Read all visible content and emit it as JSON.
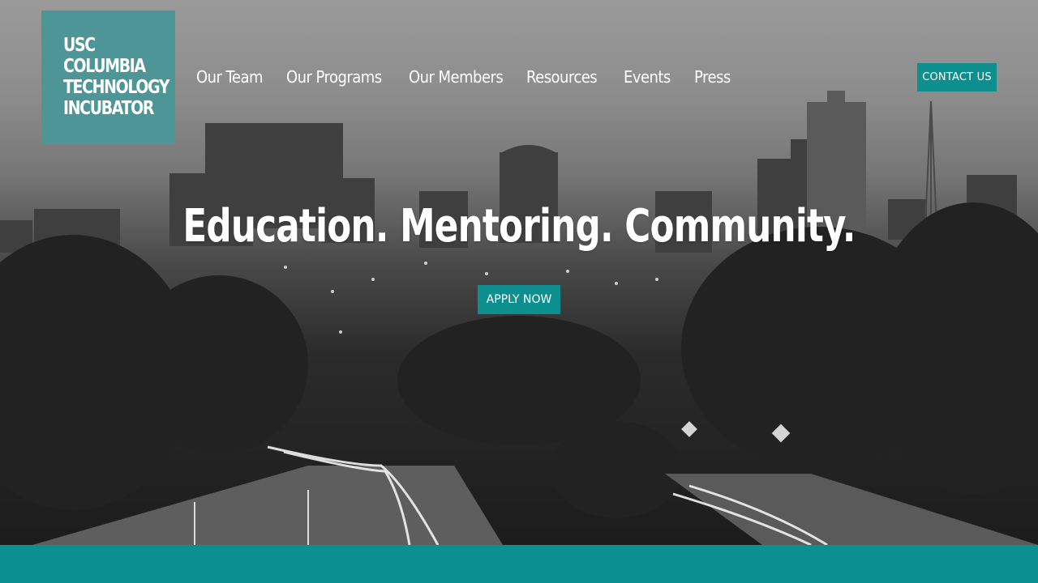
{
  "logo": {
    "lines": [
      "USC",
      "COLUMBIA",
      "TECHNOLOGY",
      "INCUBATOR"
    ],
    "background_color": "#4e9598"
  },
  "nav": {
    "items": [
      {
        "label": "Our Team"
      },
      {
        "label": "Our Programs"
      },
      {
        "label": "Our Members"
      },
      {
        "label": "Resources"
      },
      {
        "label": "Events"
      },
      {
        "label": "Press"
      }
    ]
  },
  "header": {
    "contact_label": "CONTACT US"
  },
  "hero": {
    "headline": "Education. Mentoring. Community.",
    "apply_label": "APPLY NOW",
    "image": "black-and-white city skyline at dusk with tree-lined highway and light trails"
  },
  "colors": {
    "accent": "#0e8f8f",
    "footer_band": "#0c8f91"
  }
}
